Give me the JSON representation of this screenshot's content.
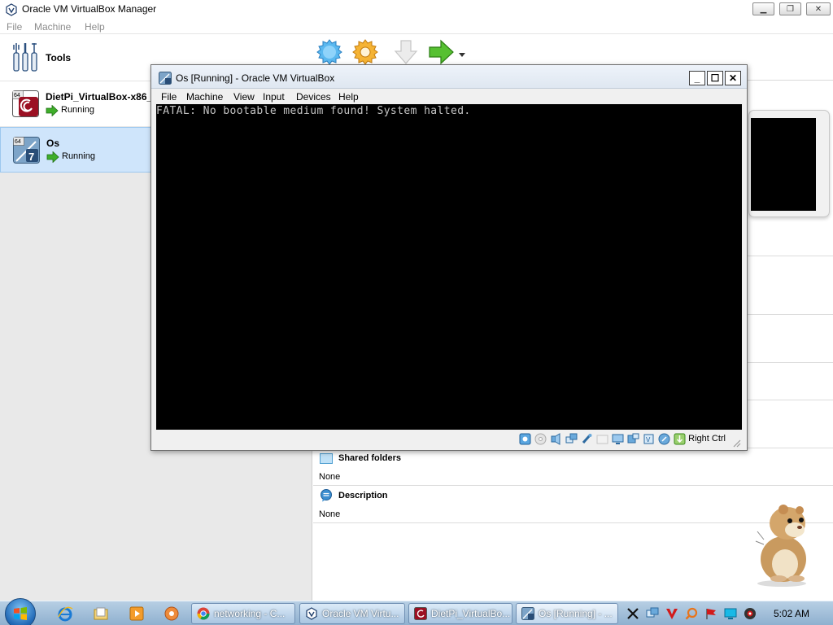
{
  "manager": {
    "title": "Oracle VM VirtualBox Manager",
    "menu": [
      "File",
      "Machine",
      "Help"
    ],
    "window_buttons": {
      "minimize": "▁",
      "restore": "❐",
      "close": "✕"
    },
    "tools_label": "Tools",
    "vms": [
      {
        "name": "DietPi_VirtualBox-x86_",
        "state": "Running",
        "os_icon": "debian-64-icon"
      },
      {
        "name": "Os",
        "state": "Running",
        "os_icon": "windows7-64-icon"
      }
    ],
    "toolbar": [
      "new-icon",
      "settings-icon",
      "discard-icon",
      "show-icon"
    ],
    "details": {
      "shared_folders": {
        "title": "Shared folders",
        "value": "None"
      },
      "description": {
        "title": "Description",
        "value": "None"
      }
    }
  },
  "vm_window": {
    "title": "Os [Running] - Oracle VM VirtualBox",
    "menu": [
      "File",
      "Machine",
      "View",
      "Input",
      "Devices",
      "Help"
    ],
    "window_buttons": {
      "minimize": "_",
      "maximize": "☐",
      "close": "✕"
    },
    "console_text": "FATAL: No bootable medium found! System halted.",
    "host_key": "Right Ctrl"
  },
  "taskbar": {
    "tasks": [
      {
        "label": "networking - C...",
        "icon": "chrome-icon"
      },
      {
        "label": "Oracle VM Virtu...",
        "icon": "virtualbox-icon"
      },
      {
        "label": "DietPi_VirtualBo...",
        "icon": "vm-debian-icon"
      },
      {
        "label": "Os [Running] - ...",
        "icon": "vm-win7-icon"
      }
    ],
    "clock": "5:02 AM"
  },
  "colors": {
    "selection": "#cfe5fb",
    "running_arrow": "#3fae2a",
    "console_bg": "#000000",
    "console_text": "#c4c4c4"
  }
}
